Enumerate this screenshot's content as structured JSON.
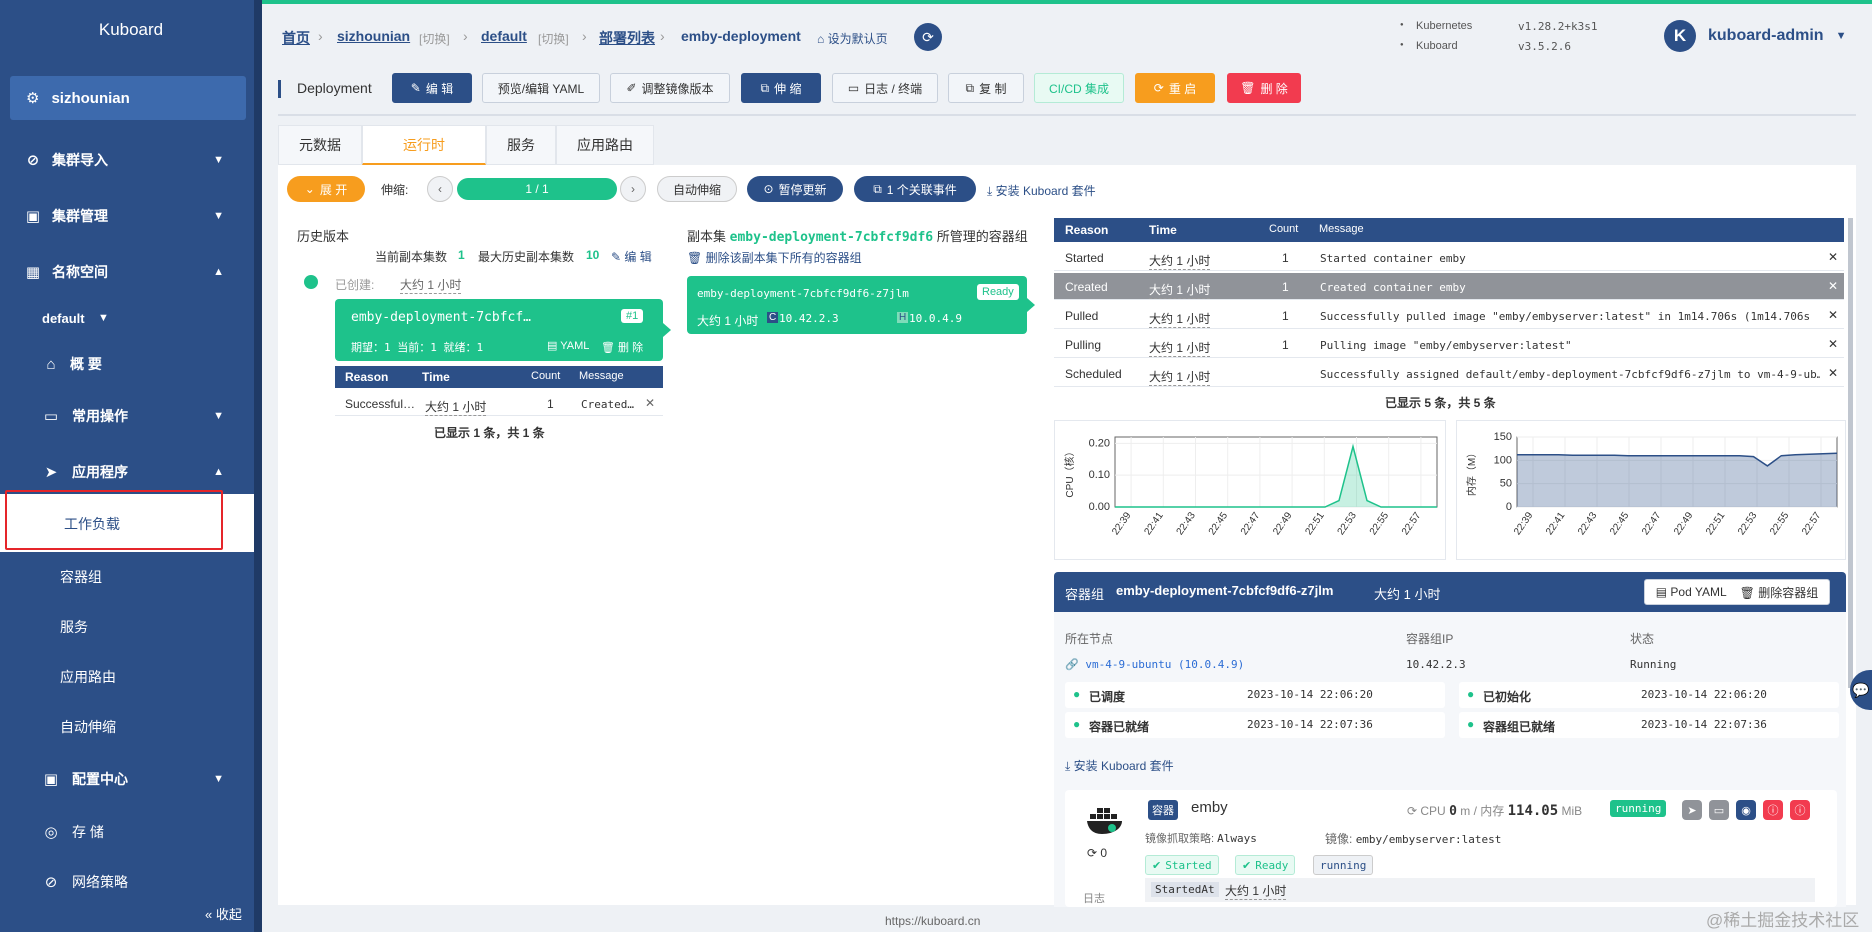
{
  "sidebar": {
    "brand": "Kuboard",
    "cluster": "sizhounian",
    "items": [
      {
        "label": "集群导入",
        "icon": "link-icon"
      },
      {
        "label": "集群管理",
        "icon": "briefcase-icon"
      },
      {
        "label": "名称空间",
        "icon": "grid-icon"
      }
    ],
    "namespace": "default",
    "ns_items": [
      {
        "label": "概 要",
        "icon": "home-icon"
      },
      {
        "label": "常用操作",
        "icon": "folder-icon"
      },
      {
        "label": "应用程序",
        "icon": "send-icon"
      }
    ],
    "app_subitems": [
      "工作负载",
      "容器组",
      "服务",
      "应用路由",
      "自动伸缩"
    ],
    "bottom_items": [
      {
        "label": "配置中心",
        "icon": "briefcase-icon"
      },
      {
        "label": "存 储",
        "icon": "database-icon"
      },
      {
        "label": "网络策略",
        "icon": "link-icon"
      }
    ],
    "collapse": "« 收起"
  },
  "breadcrumb": {
    "home": "首页",
    "cluster": "sizhounian",
    "switch": "[切换]",
    "namespace": "default",
    "list": "部署列表",
    "current": "emby-deployment",
    "set_default": "设为默认页"
  },
  "version": {
    "k8s_label": "Kubernetes",
    "k8s_value": "v1.28.2+k3s1",
    "kuboard_label": "Kuboard",
    "kuboard_value": "v3.5.2.6"
  },
  "user": {
    "avatar": "K",
    "name": "kuboard-admin"
  },
  "toolbar": {
    "kind": "Deployment",
    "edit": "编 辑",
    "yaml": "预览/编辑 YAML",
    "image": "调整镜像版本",
    "scale": "伸 缩",
    "logs": "日志 / 终端",
    "copy": "复 制",
    "cicd": "CI/CD 集成",
    "restart": "重 启",
    "delete": "删 除"
  },
  "tabs": [
    "元数据",
    "运行时",
    "服务",
    "应用路由"
  ],
  "runtime_bar": {
    "expand": "展 开",
    "scale_label": "伸缩:",
    "scale_value": "1 / 1",
    "autoscale": "自动伸缩",
    "pause": "暂停更新",
    "events": "1 个关联事件",
    "install": "安装 Kuboard 套件"
  },
  "history": {
    "title": "历史版本",
    "current_replicas_label": "当前副本集数",
    "current_replicas": "1",
    "max_history_label": "最大历史副本集数",
    "max_history": "10",
    "edit": "编 辑",
    "created_label": "已创建:",
    "created_value": "大约 1 小时",
    "rs_name": "emby-deployment-7cbfcf…",
    "rs_badge": "#1",
    "rs_status": "期望：1 当前：1 就绪：1",
    "rs_yaml": "YAML",
    "rs_delete": "删 除",
    "headers": [
      "Reason",
      "Time",
      "Count",
      "Message"
    ],
    "rows": [
      {
        "reason": "Successful…",
        "time": "大约 1 小时",
        "count": "1",
        "message": "Created…"
      }
    ],
    "footer": "已显示 1 条，共 1 条"
  },
  "replicaset": {
    "title_prefix": "副本集",
    "name": "emby-deployment-7cbfcf9df6",
    "title_suffix": "所管理的容器组",
    "delete_all": "删除该副本集下所有的容器组",
    "pod_name": "emby-deployment-7cbfcf9df6-z7jlm",
    "pod_ready": "Ready",
    "pod_age": "大约 1 小时",
    "pod_ip": "10.42.2.3",
    "host_ip": "10.0.4.9"
  },
  "events": {
    "headers": [
      "Reason",
      "Time",
      "Count",
      "Message"
    ],
    "rows": [
      {
        "reason": "Started",
        "time": "大约 1 小时",
        "count": "1",
        "message": "Started container emby"
      },
      {
        "reason": "Created",
        "time": "大约 1 小时",
        "count": "1",
        "message": "Created container emby"
      },
      {
        "reason": "Pulled",
        "time": "大约 1 小时",
        "count": "1",
        "message": "Successfully pulled image \"emby/embyserver:latest\" in 1m14.706s (1m14.706s"
      },
      {
        "reason": "Pulling",
        "time": "大约 1 小时",
        "count": "1",
        "message": "Pulling image \"emby/embyserver:latest\""
      },
      {
        "reason": "Scheduled",
        "time": "大约 1 小时",
        "count": "",
        "message": "Successfully assigned default/emby-deployment-7cbfcf9df6-z7jlm to vm-4-9-ub…"
      }
    ],
    "footer": "已显示 5 条，共 5 条"
  },
  "chart_data": [
    {
      "type": "line",
      "ylabel": "CPU（核）",
      "x": [
        "22:39",
        "22:41",
        "22:43",
        "22:45",
        "22:47",
        "22:49",
        "22:51",
        "22:53",
        "22:55",
        "22:57"
      ],
      "y_ticks": [
        0,
        0.1,
        0.2
      ],
      "ylim": [
        0,
        0.22
      ],
      "series": [
        {
          "values": [
            0,
            0,
            0,
            0,
            0,
            0,
            0,
            0,
            0,
            0,
            0,
            0,
            0,
            0,
            0,
            0,
            0.02,
            0.19,
            0.02,
            0,
            0,
            0,
            0,
            0
          ]
        }
      ],
      "color": "#1ec28b"
    },
    {
      "type": "area",
      "ylabel": "内存（M）",
      "x": [
        "22:39",
        "22:41",
        "22:43",
        "22:45",
        "22:47",
        "22:49",
        "22:51",
        "22:53",
        "22:55",
        "22:57"
      ],
      "y_ticks": [
        0,
        50,
        100,
        150
      ],
      "ylim": [
        0,
        150
      ],
      "series": [
        {
          "values": [
            112,
            112,
            112,
            112,
            111,
            111,
            111,
            111,
            110,
            110,
            110,
            110,
            110,
            110,
            110,
            110,
            110,
            108,
            88,
            110,
            112,
            113,
            114,
            115
          ]
        }
      ],
      "color": "#2c4f87"
    }
  ],
  "pod": {
    "title_prefix": "容器组",
    "name": "emby-deployment-7cbfcf9df6-z7jlm",
    "age": "大约 1 小时",
    "pod_yaml": "Pod YAML",
    "delete_pod": "删除容器组",
    "node_label": "所在节点",
    "node_value": "vm-4-9-ubuntu (10.0.4.9)",
    "ip_label": "容器组IP",
    "ip_value": "10.42.2.3",
    "status_label": "状态",
    "status_value": "Running",
    "conditions": [
      {
        "label": "已调度",
        "time": "2023-10-14 22:06:20"
      },
      {
        "label": "已初始化",
        "time": "2023-10-14 22:06:20"
      },
      {
        "label": "容器已就绪",
        "time": "2023-10-14 22:07:36"
      },
      {
        "label": "容器组已就绪",
        "time": "2023-10-14 22:07:36"
      }
    ],
    "install": "安装 Kuboard 套件"
  },
  "container": {
    "tag": "容器",
    "name": "emby",
    "restarts": "0",
    "cpu_label": "CPU",
    "cpu_value": "0",
    "cpu_unit": "m / 内存",
    "mem_value": "114.05",
    "mem_unit": "MiB",
    "state": "running",
    "pull_label": "镜像抓取策略:",
    "pull_value": "Always",
    "image_label": "镜像:",
    "image_value": "emby/embyserver:latest",
    "chip_started": "Started",
    "chip_ready": "Ready",
    "chip_running": "running",
    "started_at_label": "StartedAt",
    "started_at_value": "大约 1 小时",
    "logs_label": "日志"
  },
  "footer": {
    "url": "https://kuboard.cn",
    "watermark": "@稀土掘金技术社区"
  },
  "colors": {
    "primary": "#2c4f87",
    "accent": "#1ec28b",
    "orange": "#f79d1e",
    "red": "#f23b4f"
  }
}
